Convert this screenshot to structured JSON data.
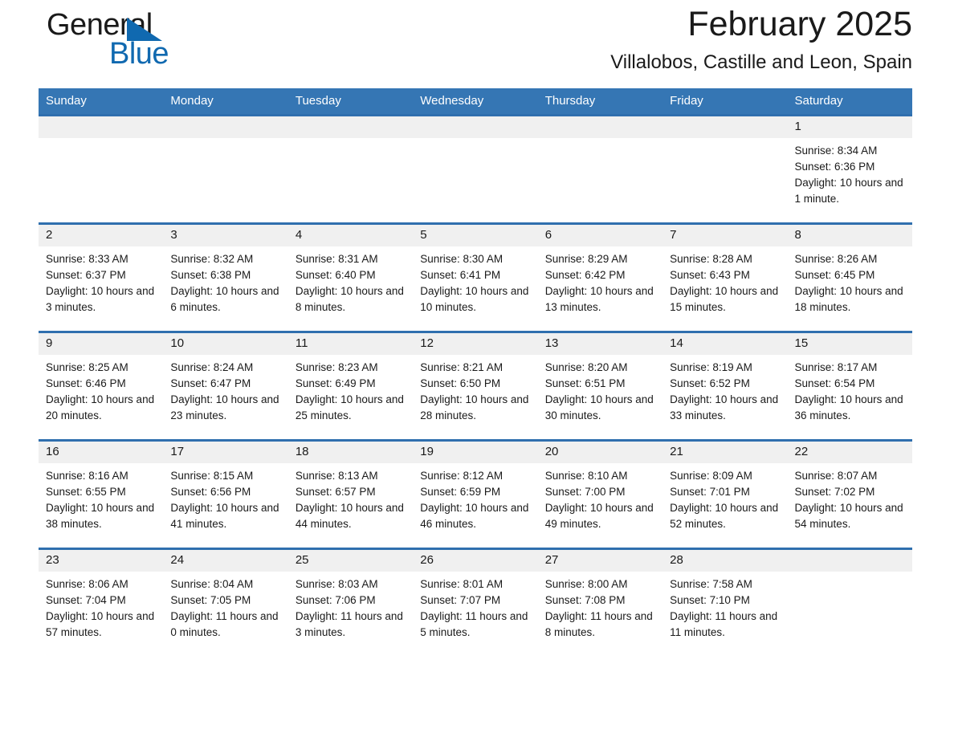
{
  "brand": {
    "name_part1": "General",
    "name_part2": "Blue",
    "triangle_color": "#1069b0"
  },
  "header": {
    "month_title": "February 2025",
    "location": "Villalobos, Castille and Leon, Spain"
  },
  "theme": {
    "header_blue": "#3576b4",
    "rule_blue": "#2f6fae",
    "daynum_band": "#f0f0f0"
  },
  "weekday_headers": [
    "Sunday",
    "Monday",
    "Tuesday",
    "Wednesday",
    "Thursday",
    "Friday",
    "Saturday"
  ],
  "labels": {
    "sunrise_prefix": "Sunrise:",
    "sunset_prefix": "Sunset:",
    "daylight_prefix": "Daylight:"
  },
  "weeks": [
    [
      {
        "day": "",
        "sunrise": "",
        "sunset": "",
        "daylight": "",
        "blank": true
      },
      {
        "day": "",
        "sunrise": "",
        "sunset": "",
        "daylight": "",
        "blank": true
      },
      {
        "day": "",
        "sunrise": "",
        "sunset": "",
        "daylight": "",
        "blank": true
      },
      {
        "day": "",
        "sunrise": "",
        "sunset": "",
        "daylight": "",
        "blank": true
      },
      {
        "day": "",
        "sunrise": "",
        "sunset": "",
        "daylight": "",
        "blank": true
      },
      {
        "day": "",
        "sunrise": "",
        "sunset": "",
        "daylight": "",
        "blank": true
      },
      {
        "day": "1",
        "sunrise": "Sunrise: 8:34 AM",
        "sunset": "Sunset: 6:36 PM",
        "daylight": "Daylight: 10 hours and 1 minute.",
        "blank": false
      }
    ],
    [
      {
        "day": "2",
        "sunrise": "Sunrise: 8:33 AM",
        "sunset": "Sunset: 6:37 PM",
        "daylight": "Daylight: 10 hours and 3 minutes.",
        "blank": false
      },
      {
        "day": "3",
        "sunrise": "Sunrise: 8:32 AM",
        "sunset": "Sunset: 6:38 PM",
        "daylight": "Daylight: 10 hours and 6 minutes.",
        "blank": false
      },
      {
        "day": "4",
        "sunrise": "Sunrise: 8:31 AM",
        "sunset": "Sunset: 6:40 PM",
        "daylight": "Daylight: 10 hours and 8 minutes.",
        "blank": false
      },
      {
        "day": "5",
        "sunrise": "Sunrise: 8:30 AM",
        "sunset": "Sunset: 6:41 PM",
        "daylight": "Daylight: 10 hours and 10 minutes.",
        "blank": false
      },
      {
        "day": "6",
        "sunrise": "Sunrise: 8:29 AM",
        "sunset": "Sunset: 6:42 PM",
        "daylight": "Daylight: 10 hours and 13 minutes.",
        "blank": false
      },
      {
        "day": "7",
        "sunrise": "Sunrise: 8:28 AM",
        "sunset": "Sunset: 6:43 PM",
        "daylight": "Daylight: 10 hours and 15 minutes.",
        "blank": false
      },
      {
        "day": "8",
        "sunrise": "Sunrise: 8:26 AM",
        "sunset": "Sunset: 6:45 PM",
        "daylight": "Daylight: 10 hours and 18 minutes.",
        "blank": false
      }
    ],
    [
      {
        "day": "9",
        "sunrise": "Sunrise: 8:25 AM",
        "sunset": "Sunset: 6:46 PM",
        "daylight": "Daylight: 10 hours and 20 minutes.",
        "blank": false
      },
      {
        "day": "10",
        "sunrise": "Sunrise: 8:24 AM",
        "sunset": "Sunset: 6:47 PM",
        "daylight": "Daylight: 10 hours and 23 minutes.",
        "blank": false
      },
      {
        "day": "11",
        "sunrise": "Sunrise: 8:23 AM",
        "sunset": "Sunset: 6:49 PM",
        "daylight": "Daylight: 10 hours and 25 minutes.",
        "blank": false
      },
      {
        "day": "12",
        "sunrise": "Sunrise: 8:21 AM",
        "sunset": "Sunset: 6:50 PM",
        "daylight": "Daylight: 10 hours and 28 minutes.",
        "blank": false
      },
      {
        "day": "13",
        "sunrise": "Sunrise: 8:20 AM",
        "sunset": "Sunset: 6:51 PM",
        "daylight": "Daylight: 10 hours and 30 minutes.",
        "blank": false
      },
      {
        "day": "14",
        "sunrise": "Sunrise: 8:19 AM",
        "sunset": "Sunset: 6:52 PM",
        "daylight": "Daylight: 10 hours and 33 minutes.",
        "blank": false
      },
      {
        "day": "15",
        "sunrise": "Sunrise: 8:17 AM",
        "sunset": "Sunset: 6:54 PM",
        "daylight": "Daylight: 10 hours and 36 minutes.",
        "blank": false
      }
    ],
    [
      {
        "day": "16",
        "sunrise": "Sunrise: 8:16 AM",
        "sunset": "Sunset: 6:55 PM",
        "daylight": "Daylight: 10 hours and 38 minutes.",
        "blank": false
      },
      {
        "day": "17",
        "sunrise": "Sunrise: 8:15 AM",
        "sunset": "Sunset: 6:56 PM",
        "daylight": "Daylight: 10 hours and 41 minutes.",
        "blank": false
      },
      {
        "day": "18",
        "sunrise": "Sunrise: 8:13 AM",
        "sunset": "Sunset: 6:57 PM",
        "daylight": "Daylight: 10 hours and 44 minutes.",
        "blank": false
      },
      {
        "day": "19",
        "sunrise": "Sunrise: 8:12 AM",
        "sunset": "Sunset: 6:59 PM",
        "daylight": "Daylight: 10 hours and 46 minutes.",
        "blank": false
      },
      {
        "day": "20",
        "sunrise": "Sunrise: 8:10 AM",
        "sunset": "Sunset: 7:00 PM",
        "daylight": "Daylight: 10 hours and 49 minutes.",
        "blank": false
      },
      {
        "day": "21",
        "sunrise": "Sunrise: 8:09 AM",
        "sunset": "Sunset: 7:01 PM",
        "daylight": "Daylight: 10 hours and 52 minutes.",
        "blank": false
      },
      {
        "day": "22",
        "sunrise": "Sunrise: 8:07 AM",
        "sunset": "Sunset: 7:02 PM",
        "daylight": "Daylight: 10 hours and 54 minutes.",
        "blank": false
      }
    ],
    [
      {
        "day": "23",
        "sunrise": "Sunrise: 8:06 AM",
        "sunset": "Sunset: 7:04 PM",
        "daylight": "Daylight: 10 hours and 57 minutes.",
        "blank": false
      },
      {
        "day": "24",
        "sunrise": "Sunrise: 8:04 AM",
        "sunset": "Sunset: 7:05 PM",
        "daylight": "Daylight: 11 hours and 0 minutes.",
        "blank": false
      },
      {
        "day": "25",
        "sunrise": "Sunrise: 8:03 AM",
        "sunset": "Sunset: 7:06 PM",
        "daylight": "Daylight: 11 hours and 3 minutes.",
        "blank": false
      },
      {
        "day": "26",
        "sunrise": "Sunrise: 8:01 AM",
        "sunset": "Sunset: 7:07 PM",
        "daylight": "Daylight: 11 hours and 5 minutes.",
        "blank": false
      },
      {
        "day": "27",
        "sunrise": "Sunrise: 8:00 AM",
        "sunset": "Sunset: 7:08 PM",
        "daylight": "Daylight: 11 hours and 8 minutes.",
        "blank": false
      },
      {
        "day": "28",
        "sunrise": "Sunrise: 7:58 AM",
        "sunset": "Sunset: 7:10 PM",
        "daylight": "Daylight: 11 hours and 11 minutes.",
        "blank": false
      },
      {
        "day": "",
        "sunrise": "",
        "sunset": "",
        "daylight": "",
        "blank": true
      }
    ]
  ]
}
